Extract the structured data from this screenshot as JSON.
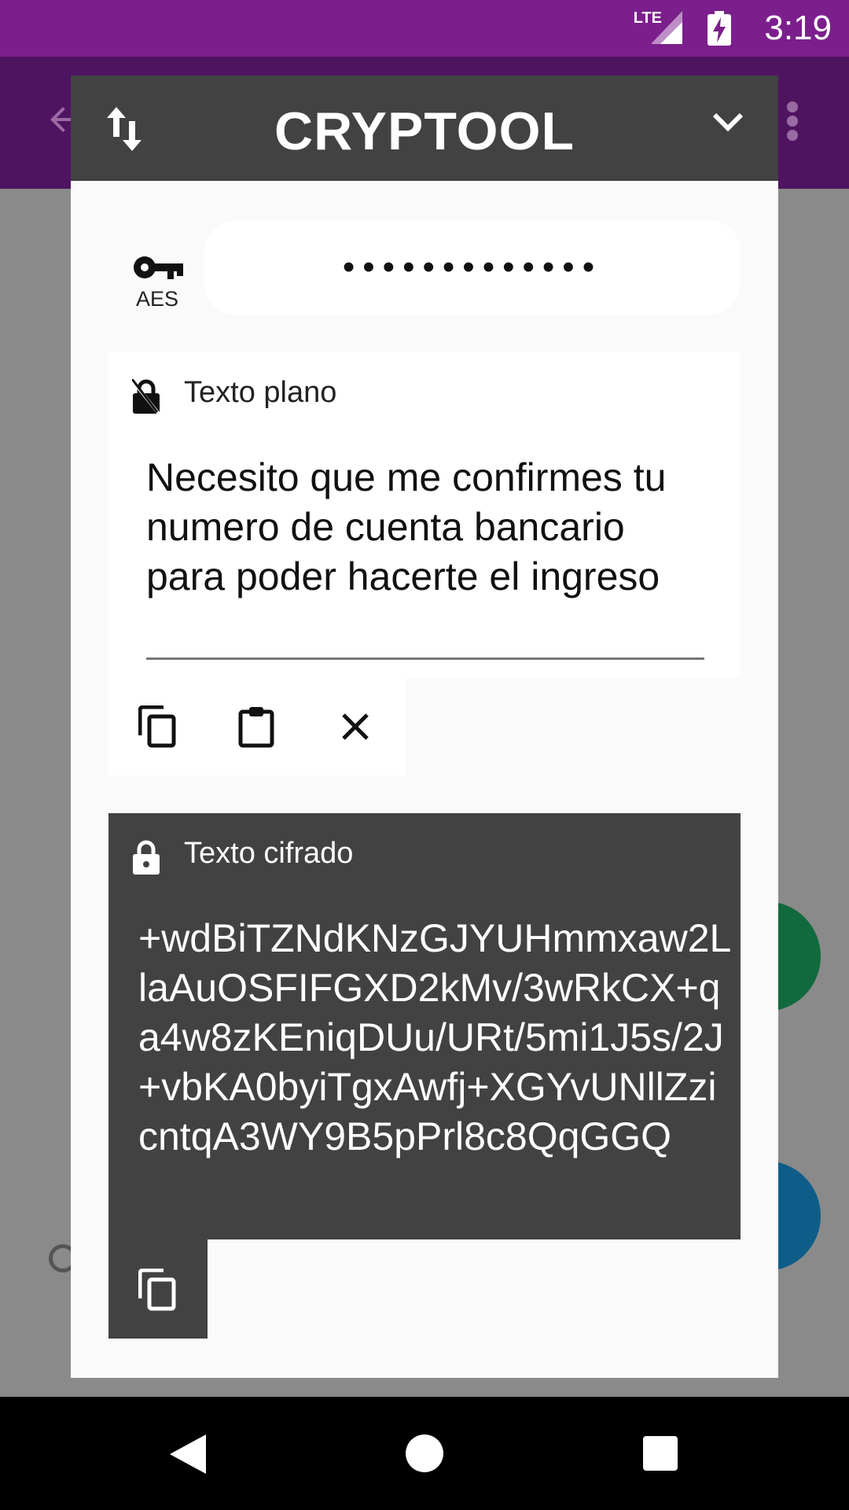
{
  "status_bar": {
    "time": "3:19",
    "network": "LTE"
  },
  "dialog": {
    "title": "CRYPTOOL",
    "algorithm_label": "AES",
    "password_value": "•••••••••••••"
  },
  "plain_card": {
    "label": "Texto plano",
    "text": "Necesito que me confirmes tu numero de cuenta bancario para poder hacerte el ingreso"
  },
  "cipher_card": {
    "label": "Texto cifrado",
    "text": "+wdBiTZNdKNzGJYUHmmxaw2LlaAuOSFIFGXD2kMv/3wRkCX+qa4w8zKEniqDUu/URt/5mi1J5s/2J+vbKA0byiTgxAwfj+XGYvUNllZzicntqA3WY9B5pPrl8c8QqGGQ"
  },
  "icons": {
    "swap": "swap-vert-icon",
    "collapse": "chevron-down-icon",
    "key": "key-icon",
    "unlocked": "no-encryption-icon",
    "locked": "lock-icon",
    "copy": "copy-icon",
    "paste": "clipboard-icon",
    "clear": "close-icon"
  },
  "colors": {
    "status_bar": "#7b1f8c",
    "dialog_header": "#424242",
    "cipher_card": "#424242",
    "fab_green": "#116a3d",
    "fab_blue": "#0e5d88"
  }
}
